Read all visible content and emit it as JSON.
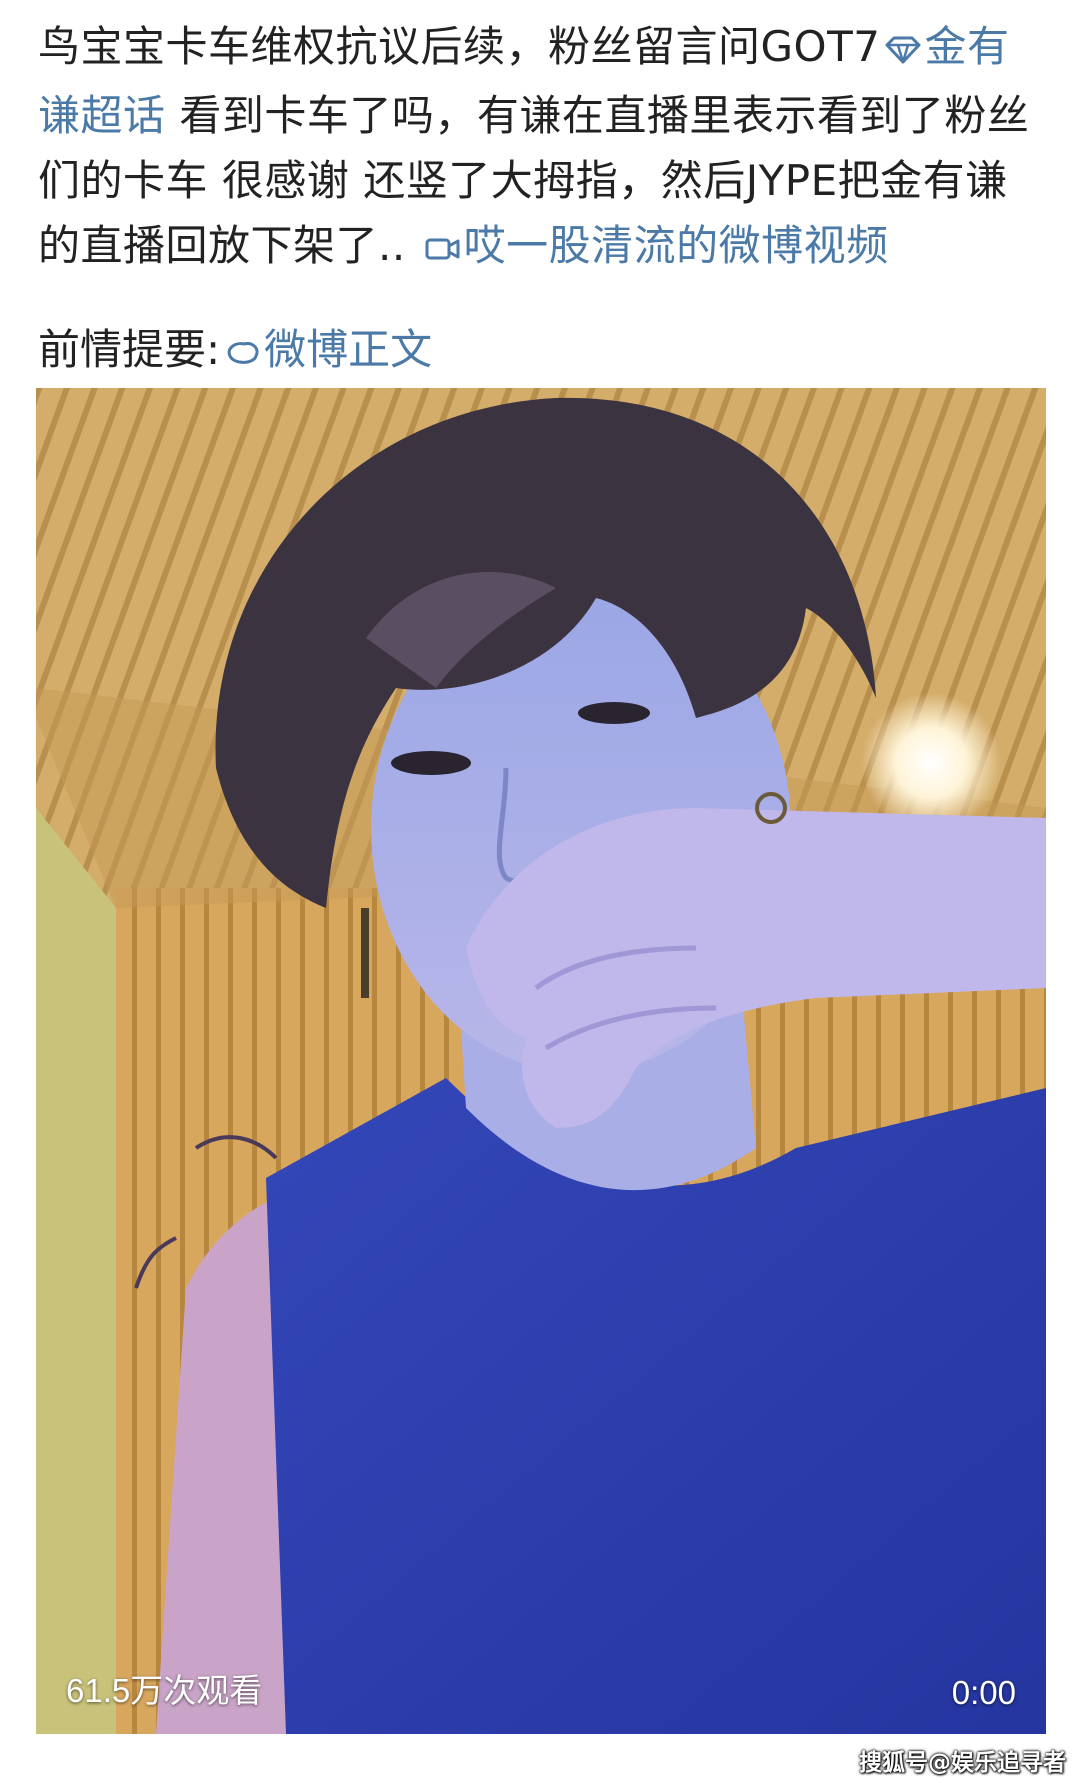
{
  "post": {
    "text_part1": "鸟宝宝卡车维权抗议后续，粉丝留言问GOT7",
    "topic_link": "金有谦超话",
    "text_part2": " 看到卡车了吗，有谦在直播里表示看到了粉丝们的卡车 很感谢 还竖了大拇指，然后JYPE把金有谦的直播回放下架了.. ",
    "video_link": "哎一股清流的微博视频",
    "intro_label": "前情提要:",
    "intro_link": "微博正文"
  },
  "video": {
    "view_count": "61.5万次观看",
    "duration": "0:00"
  },
  "watermark": "搜狐号@娱乐追寻者",
  "colors": {
    "link": "#4b7aa8",
    "text": "#222222",
    "shirt": "#2a3fb0"
  },
  "icons": {
    "topic": "diamond-icon",
    "video": "video-camera-icon",
    "weibo": "weibo-icon"
  }
}
